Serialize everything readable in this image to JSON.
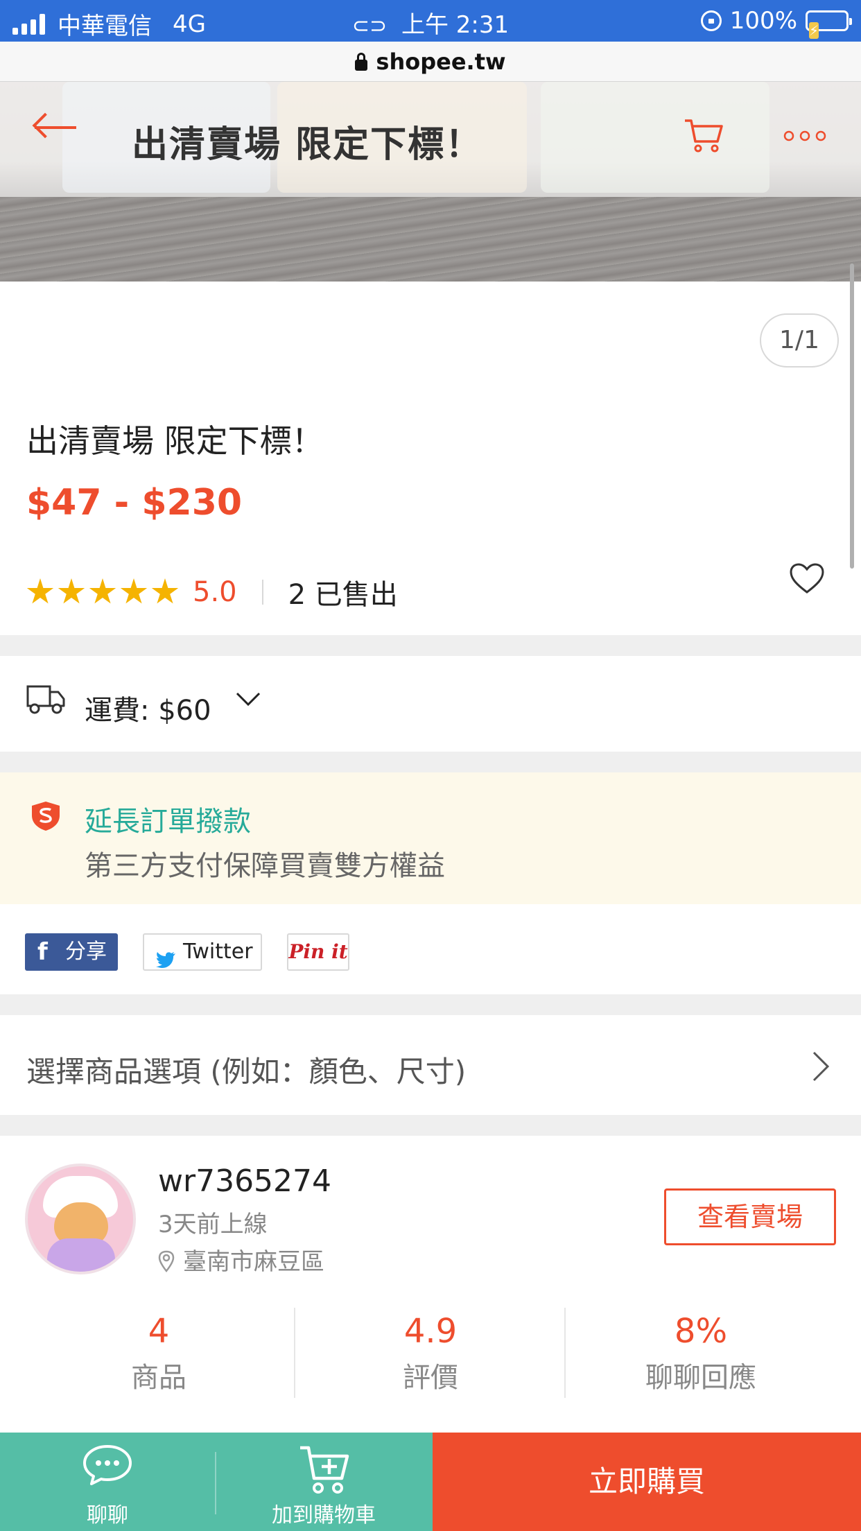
{
  "status_bar": {
    "carrier": "中華電信",
    "network": "4G",
    "time": "上午 2:31",
    "battery": "100%"
  },
  "browser": {
    "url": "shopee.tw"
  },
  "header": {
    "title": "出清賣場 限定下標！",
    "back_icon": "arrow-left-icon",
    "cart_icon": "cart-icon",
    "more_icon": "more-dots-icon"
  },
  "product": {
    "image_counter": "1/1",
    "title": "出清賣場 限定下標！",
    "price": "$47 - $230",
    "rating": "5.0",
    "stars": 5,
    "sold": "2 已售出"
  },
  "shipping": {
    "label": "運費: $60"
  },
  "guarantee": {
    "title": "延長訂單撥款",
    "subtitle": "第三方支付保障買賣雙方權益"
  },
  "share": {
    "facebook": "分享",
    "twitter": "Twitter",
    "pinterest": "Pin it"
  },
  "options": {
    "label": "選擇商品選項 (例如：顏色、尺寸)"
  },
  "shop": {
    "name": "wr7365274",
    "last_online": "3天前上線",
    "location": "臺南市麻豆區",
    "view_button": "查看賣場",
    "stats": [
      {
        "value": "4",
        "label": "商品"
      },
      {
        "value": "4.9",
        "label": "評價"
      },
      {
        "value": "8%",
        "label": "聊聊回應"
      }
    ]
  },
  "bottom_bar": {
    "chat": "聊聊",
    "add_to_cart": "加到購物車",
    "buy_now": "立即購買"
  },
  "colors": {
    "brand_orange": "#ee4d2d",
    "bottom_teal": "#55bea6",
    "guarantee_teal": "#26aa99",
    "star": "#f5b301"
  }
}
